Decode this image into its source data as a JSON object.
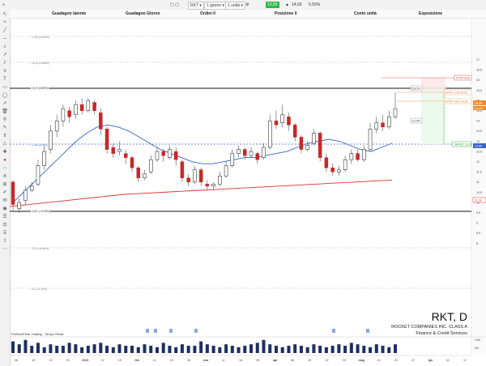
{
  "topbar": {
    "symbol": "RKT",
    "timeframe": "1 giorno",
    "quantity": "1 unità",
    "price_badge": "13,85",
    "price_change": "14,60",
    "pct_change": "5.55%"
  },
  "infobar": {
    "gain_latent": "Guadagno latente",
    "gain_day": "Guadagno Giorno",
    "orders": "Ordini 0",
    "positions": "Posizione 0",
    "account": "Conto unità",
    "exposure": "Esposizione"
  },
  "levels": {
    "top_dashed": "17,88 (18.69%)",
    "second_dashed": "16,34 (16.88%)",
    "resistance": "15,19 (8.69%)",
    "mid_dashed": "12,86 (8.09%)",
    "support": "10,81 (-19.36%)",
    "low_dashed_1": "9,75 (-30.48%)",
    "low_dashed_2": "8,0 (-42.64%)"
  },
  "order_tags": {
    "stop": "STOP 15,6",
    "entry_low": "ENTRY LOW 15,05",
    "entry_high": "ENTRY HIGH 14,65",
    "target": "TARGET 12,95",
    "tag_a": "15,47%",
    "tag_b": "13,74%"
  },
  "price_axis": [
    "17",
    "16.5",
    "16",
    "15.5",
    "15",
    "14.5",
    "14",
    "13.5",
    "13",
    "12.5",
    "12",
    "11.5",
    "11",
    "10.5",
    "10",
    "9.5",
    "9",
    "8.5",
    "8"
  ],
  "price_axis_badges": {
    "last": "14,60",
    "last2": "Stabilità",
    "ma20": "12,89",
    "ma200": "11,09"
  },
  "date_axis": [
    "08",
    "15",
    "22",
    "29",
    "2024",
    "12",
    "19",
    "feb",
    "12",
    "19",
    "26",
    "mar",
    "11",
    "18",
    "25",
    "apr",
    "08",
    "15",
    "22",
    "29",
    "mag",
    "13",
    "20",
    "27",
    "giu",
    "10",
    "17"
  ],
  "ticker_block": {
    "symbol": "RKT, D",
    "name": "ROCKET COMPANIES INC. CLASS A",
    "sector": "Finance & Credit Services"
  },
  "footer_brand": "ProRealTime Trading - Tempo Reale",
  "volume_axis": [
    "10M",
    "5M"
  ],
  "chart_data": {
    "type": "candlestick",
    "candles": [
      [
        11.0,
        9.9,
        11.1,
        9.6
      ],
      [
        9.7,
        10.0,
        10.2,
        9.5
      ],
      [
        10.1,
        10.6,
        10.8,
        9.9
      ],
      [
        10.6,
        10.8,
        11.0,
        10.5
      ],
      [
        10.9,
        11.8,
        12.1,
        10.8
      ],
      [
        11.8,
        12.5,
        12.8,
        11.6
      ],
      [
        12.6,
        13.5,
        13.8,
        12.4
      ],
      [
        13.5,
        14.0,
        14.3,
        13.2
      ],
      [
        14.0,
        14.6,
        14.8,
        13.7
      ],
      [
        14.5,
        14.2,
        14.7,
        13.9
      ],
      [
        14.3,
        14.8,
        15.0,
        14.1
      ],
      [
        14.8,
        14.5,
        15.1,
        14.3
      ],
      [
        14.5,
        15.0,
        15.1,
        14.4
      ],
      [
        14.9,
        14.5,
        15.0,
        14.3
      ],
      [
        14.4,
        13.6,
        14.6,
        13.3
      ],
      [
        13.6,
        12.6,
        13.7,
        12.4
      ],
      [
        12.7,
        12.4,
        12.9,
        12.2
      ],
      [
        12.5,
        12.6,
        13.0,
        12.3
      ],
      [
        12.4,
        12.2,
        12.6,
        11.9
      ],
      [
        12.2,
        11.7,
        12.3,
        11.5
      ],
      [
        11.7,
        11.2,
        11.8,
        11.0
      ],
      [
        11.2,
        11.4,
        11.6,
        11.1
      ],
      [
        11.5,
        12.1,
        12.3,
        11.4
      ],
      [
        12.1,
        12.5,
        12.7,
        12.0
      ],
      [
        12.5,
        12.3,
        12.6,
        12.0
      ],
      [
        12.2,
        12.6,
        12.8,
        12.1
      ],
      [
        12.5,
        12.1,
        12.7,
        11.8
      ],
      [
        12.0,
        11.2,
        12.1,
        11.0
      ],
      [
        11.2,
        11.0,
        11.4,
        10.8
      ],
      [
        11.0,
        11.6,
        11.8,
        10.9
      ],
      [
        11.6,
        11.0,
        11.7,
        10.8
      ],
      [
        10.9,
        10.8,
        11.1,
        10.6
      ],
      [
        10.8,
        10.9,
        11.0,
        10.6
      ],
      [
        10.9,
        11.3,
        11.5,
        10.8
      ],
      [
        11.3,
        11.8,
        12.0,
        11.2
      ],
      [
        11.8,
        12.4,
        12.6,
        11.7
      ],
      [
        12.4,
        12.6,
        12.8,
        12.2
      ],
      [
        12.6,
        12.3,
        12.7,
        12.1
      ],
      [
        12.3,
        12.5,
        12.7,
        12.2
      ],
      [
        12.4,
        12.1,
        12.5,
        11.9
      ],
      [
        12.2,
        12.7,
        12.9,
        12.1
      ],
      [
        12.7,
        14.0,
        14.3,
        12.6
      ],
      [
        14.0,
        13.8,
        14.5,
        13.6
      ],
      [
        13.9,
        14.3,
        14.8,
        13.7
      ],
      [
        14.2,
        13.8,
        14.4,
        13.5
      ],
      [
        13.8,
        13.2,
        13.9,
        13.0
      ],
      [
        13.2,
        12.6,
        13.3,
        12.4
      ],
      [
        12.6,
        12.8,
        13.0,
        12.5
      ],
      [
        12.9,
        13.4,
        13.6,
        12.8
      ],
      [
        13.4,
        12.2,
        13.5,
        12.0
      ],
      [
        12.2,
        11.7,
        12.4,
        11.5
      ],
      [
        11.7,
        11.5,
        11.9,
        11.3
      ],
      [
        11.5,
        11.6,
        11.8,
        11.3
      ],
      [
        11.6,
        12.1,
        12.3,
        11.5
      ],
      [
        12.1,
        12.4,
        12.6,
        11.9
      ],
      [
        12.4,
        12.1,
        12.6,
        12.0
      ],
      [
        12.1,
        12.6,
        12.8,
        12.0
      ],
      [
        12.6,
        13.6,
        13.9,
        12.5
      ],
      [
        13.6,
        13.9,
        14.2,
        13.4
      ],
      [
        13.9,
        13.7,
        14.3,
        13.5
      ],
      [
        13.7,
        14.2,
        14.5,
        13.6
      ],
      [
        14.2,
        14.6,
        15.4,
        14.1
      ]
    ],
    "ma20": [
      10.0,
      10.5,
      11.0,
      11.5,
      12.0,
      12.5,
      13.0,
      13.4,
      13.7,
      13.8,
      13.7,
      13.5,
      13.2,
      12.9,
      12.6,
      12.4,
      12.2,
      12.0,
      11.9,
      11.9,
      12.0,
      12.1,
      12.2,
      12.2,
      12.3,
      12.4,
      12.5,
      12.7,
      12.9,
      13.0,
      13.1,
      13.0,
      12.8,
      12.6,
      12.5,
      12.7,
      12.9
    ],
    "ma200": [
      9.8,
      9.9,
      10.0,
      10.1,
      10.2,
      10.3,
      10.4,
      10.45,
      10.5,
      10.55,
      10.6,
      10.65,
      10.7,
      10.75,
      10.8,
      10.85,
      10.9,
      10.95,
      11.0,
      11.05,
      11.1
    ],
    "volume": [
      8,
      6,
      9,
      5,
      7,
      4,
      6,
      5,
      5,
      7,
      6,
      4,
      5,
      6,
      7,
      5,
      4,
      6,
      5,
      5,
      4,
      6,
      5,
      4,
      7,
      5,
      4,
      6,
      5,
      5,
      8,
      6,
      5,
      4,
      6,
      5,
      4,
      5,
      6,
      7,
      9,
      6,
      5,
      4,
      5,
      6,
      5,
      4,
      6,
      5,
      4,
      5,
      6,
      5,
      7,
      6,
      5,
      4,
      6,
      5,
      4,
      6
    ]
  }
}
